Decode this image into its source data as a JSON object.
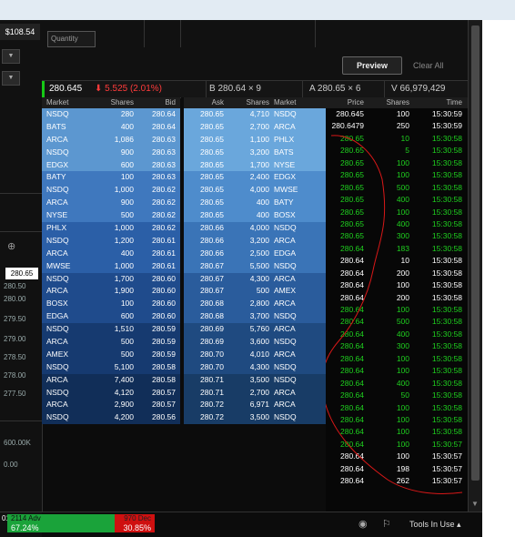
{
  "left": {
    "price_top": "$108.54",
    "axis": [
      "280.50",
      "280.00",
      "279.50",
      "279.00",
      "278.50",
      "278.00",
      "277.50"
    ],
    "current_price": "280.65",
    "lower_axis": [
      "600.00K",
      "0.00"
    ],
    "year": "018"
  },
  "order_entry": {
    "quantity_placeholder": "Quantity",
    "preview_label": "Preview",
    "clear_label": "Clear All"
  },
  "quote": {
    "last": "280.645",
    "change": "5.525 (2.01%)",
    "bid": "B 280.64 × 9",
    "ask": "A 280.65 × 6",
    "volume": "V 66,979,429"
  },
  "book_headers": {
    "market": "Market",
    "shares": "Shares",
    "bid": "Bid",
    "ask": "Ask",
    "ask_shares": "Shares",
    "ask_market": "Market"
  },
  "bids": [
    {
      "mkt": "NSDQ",
      "sh": "280",
      "px": "280.64"
    },
    {
      "mkt": "BATS",
      "sh": "400",
      "px": "280.64"
    },
    {
      "mkt": "ARCA",
      "sh": "1,086",
      "px": "280.63"
    },
    {
      "mkt": "NSDQ",
      "sh": "900",
      "px": "280.63"
    },
    {
      "mkt": "EDGX",
      "sh": "600",
      "px": "280.63"
    },
    {
      "mkt": "BATY",
      "sh": "100",
      "px": "280.63"
    },
    {
      "mkt": "NSDQ",
      "sh": "1,000",
      "px": "280.62"
    },
    {
      "mkt": "ARCA",
      "sh": "900",
      "px": "280.62"
    },
    {
      "mkt": "NYSE",
      "sh": "500",
      "px": "280.62"
    },
    {
      "mkt": "PHLX",
      "sh": "1,000",
      "px": "280.62"
    },
    {
      "mkt": "NSDQ",
      "sh": "1,200",
      "px": "280.61"
    },
    {
      "mkt": "ARCA",
      "sh": "400",
      "px": "280.61"
    },
    {
      "mkt": "MWSE",
      "sh": "1,000",
      "px": "280.61"
    },
    {
      "mkt": "NSDQ",
      "sh": "1,700",
      "px": "280.60"
    },
    {
      "mkt": "ARCA",
      "sh": "1,900",
      "px": "280.60"
    },
    {
      "mkt": "BOSX",
      "sh": "100",
      "px": "280.60"
    },
    {
      "mkt": "EDGA",
      "sh": "600",
      "px": "280.60"
    },
    {
      "mkt": "NSDQ",
      "sh": "1,510",
      "px": "280.59"
    },
    {
      "mkt": "ARCA",
      "sh": "500",
      "px": "280.59"
    },
    {
      "mkt": "AMEX",
      "sh": "500",
      "px": "280.59"
    },
    {
      "mkt": "NSDQ",
      "sh": "5,100",
      "px": "280.58"
    },
    {
      "mkt": "ARCA",
      "sh": "7,400",
      "px": "280.58"
    },
    {
      "mkt": "NSDQ",
      "sh": "4,120",
      "px": "280.57"
    },
    {
      "mkt": "ARCA",
      "sh": "2,900",
      "px": "280.57"
    },
    {
      "mkt": "NSDQ",
      "sh": "4,200",
      "px": "280.56"
    }
  ],
  "asks": [
    {
      "px": "280.65",
      "sh": "4,710",
      "mkt": "NSDQ"
    },
    {
      "px": "280.65",
      "sh": "2,700",
      "mkt": "ARCA"
    },
    {
      "px": "280.65",
      "sh": "1,100",
      "mkt": "PHLX"
    },
    {
      "px": "280.65",
      "sh": "3,200",
      "mkt": "BATS"
    },
    {
      "px": "280.65",
      "sh": "1,700",
      "mkt": "NYSE"
    },
    {
      "px": "280.65",
      "sh": "2,400",
      "mkt": "EDGX"
    },
    {
      "px": "280.65",
      "sh": "4,000",
      "mkt": "MWSE"
    },
    {
      "px": "280.65",
      "sh": "400",
      "mkt": "BATY"
    },
    {
      "px": "280.65",
      "sh": "400",
      "mkt": "BOSX"
    },
    {
      "px": "280.66",
      "sh": "4,000",
      "mkt": "NSDQ"
    },
    {
      "px": "280.66",
      "sh": "3,200",
      "mkt": "ARCA"
    },
    {
      "px": "280.66",
      "sh": "2,500",
      "mkt": "EDGA"
    },
    {
      "px": "280.67",
      "sh": "5,500",
      "mkt": "NSDQ"
    },
    {
      "px": "280.67",
      "sh": "4,300",
      "mkt": "ARCA"
    },
    {
      "px": "280.67",
      "sh": "500",
      "mkt": "AMEX"
    },
    {
      "px": "280.68",
      "sh": "2,800",
      "mkt": "ARCA"
    },
    {
      "px": "280.68",
      "sh": "3,700",
      "mkt": "NSDQ"
    },
    {
      "px": "280.69",
      "sh": "5,760",
      "mkt": "ARCA"
    },
    {
      "px": "280.69",
      "sh": "3,600",
      "mkt": "NSDQ"
    },
    {
      "px": "280.70",
      "sh": "4,010",
      "mkt": "ARCA"
    },
    {
      "px": "280.70",
      "sh": "4,300",
      "mkt": "NSDQ"
    },
    {
      "px": "280.71",
      "sh": "3,500",
      "mkt": "NSDQ"
    },
    {
      "px": "280.71",
      "sh": "2,700",
      "mkt": "ARCA"
    },
    {
      "px": "280.72",
      "sh": "6,971",
      "mkt": "ARCA"
    },
    {
      "px": "280.72",
      "sh": "3,500",
      "mkt": "NSDQ"
    }
  ],
  "ts_headers": {
    "price": "Price",
    "shares": "Shares",
    "time": "Time"
  },
  "trades": [
    {
      "px": "280.645",
      "sh": "100",
      "t": "15:30:59",
      "c": "w"
    },
    {
      "px": "280.6479",
      "sh": "250",
      "t": "15:30:59",
      "c": "w"
    },
    {
      "px": "280.65",
      "sh": "10",
      "t": "15:30:58",
      "c": "g"
    },
    {
      "px": "280.65",
      "sh": "5",
      "t": "15:30:58",
      "c": "g"
    },
    {
      "px": "280.65",
      "sh": "100",
      "t": "15:30:58",
      "c": "g"
    },
    {
      "px": "280.65",
      "sh": "100",
      "t": "15:30:58",
      "c": "g"
    },
    {
      "px": "280.65",
      "sh": "500",
      "t": "15:30:58",
      "c": "g"
    },
    {
      "px": "280.65",
      "sh": "400",
      "t": "15:30:58",
      "c": "g"
    },
    {
      "px": "280.65",
      "sh": "100",
      "t": "15:30:58",
      "c": "g"
    },
    {
      "px": "280.65",
      "sh": "400",
      "t": "15:30:58",
      "c": "g"
    },
    {
      "px": "280.65",
      "sh": "300",
      "t": "15:30:58",
      "c": "g"
    },
    {
      "px": "280.64",
      "sh": "183",
      "t": "15:30:58",
      "c": "g"
    },
    {
      "px": "280.64",
      "sh": "10",
      "t": "15:30:58",
      "c": "w"
    },
    {
      "px": "280.64",
      "sh": "200",
      "t": "15:30:58",
      "c": "w"
    },
    {
      "px": "280.64",
      "sh": "100",
      "t": "15:30:58",
      "c": "w"
    },
    {
      "px": "280.64",
      "sh": "200",
      "t": "15:30:58",
      "c": "w"
    },
    {
      "px": "280.64",
      "sh": "100",
      "t": "15:30:58",
      "c": "g"
    },
    {
      "px": "280.64",
      "sh": "500",
      "t": "15:30:58",
      "c": "g"
    },
    {
      "px": "280.64",
      "sh": "400",
      "t": "15:30:58",
      "c": "g"
    },
    {
      "px": "280.64",
      "sh": "300",
      "t": "15:30:58",
      "c": "g"
    },
    {
      "px": "280.64",
      "sh": "100",
      "t": "15:30:58",
      "c": "g"
    },
    {
      "px": "280.64",
      "sh": "100",
      "t": "15:30:58",
      "c": "g"
    },
    {
      "px": "280.64",
      "sh": "400",
      "t": "15:30:58",
      "c": "g"
    },
    {
      "px": "280.64",
      "sh": "50",
      "t": "15:30:58",
      "c": "g"
    },
    {
      "px": "280.64",
      "sh": "100",
      "t": "15:30:58",
      "c": "g"
    },
    {
      "px": "280.64",
      "sh": "100",
      "t": "15:30:58",
      "c": "g"
    },
    {
      "px": "280.64",
      "sh": "100",
      "t": "15:30:58",
      "c": "g"
    },
    {
      "px": "280.64",
      "sh": "100",
      "t": "15:30:57",
      "c": "g"
    },
    {
      "px": "280.64",
      "sh": "100",
      "t": "15:30:57",
      "c": "w"
    },
    {
      "px": "280.64",
      "sh": "198",
      "t": "15:30:57",
      "c": "w"
    },
    {
      "px": "280.64",
      "sh": "262",
      "t": "15:30:57",
      "c": "w"
    }
  ],
  "breadth": {
    "adv_label": "2114 Adv",
    "adv_pct": "67.24%",
    "dec_label": "970 Dec",
    "dec_pct": "30.85%"
  },
  "tools_label": "Tools In Use",
  "colors": {
    "bid_rows": [
      "#5c97d0",
      "#3f78be",
      "#2b5fa7",
      "#1f4b8c",
      "#163a70",
      "#112e58"
    ],
    "ask_rows": [
      "#6aa7dc",
      "#4e8ccc",
      "#3a74b7",
      "#2a5c9c",
      "#1f4a80",
      "#183c66"
    ],
    "green": "#1fd11f"
  }
}
